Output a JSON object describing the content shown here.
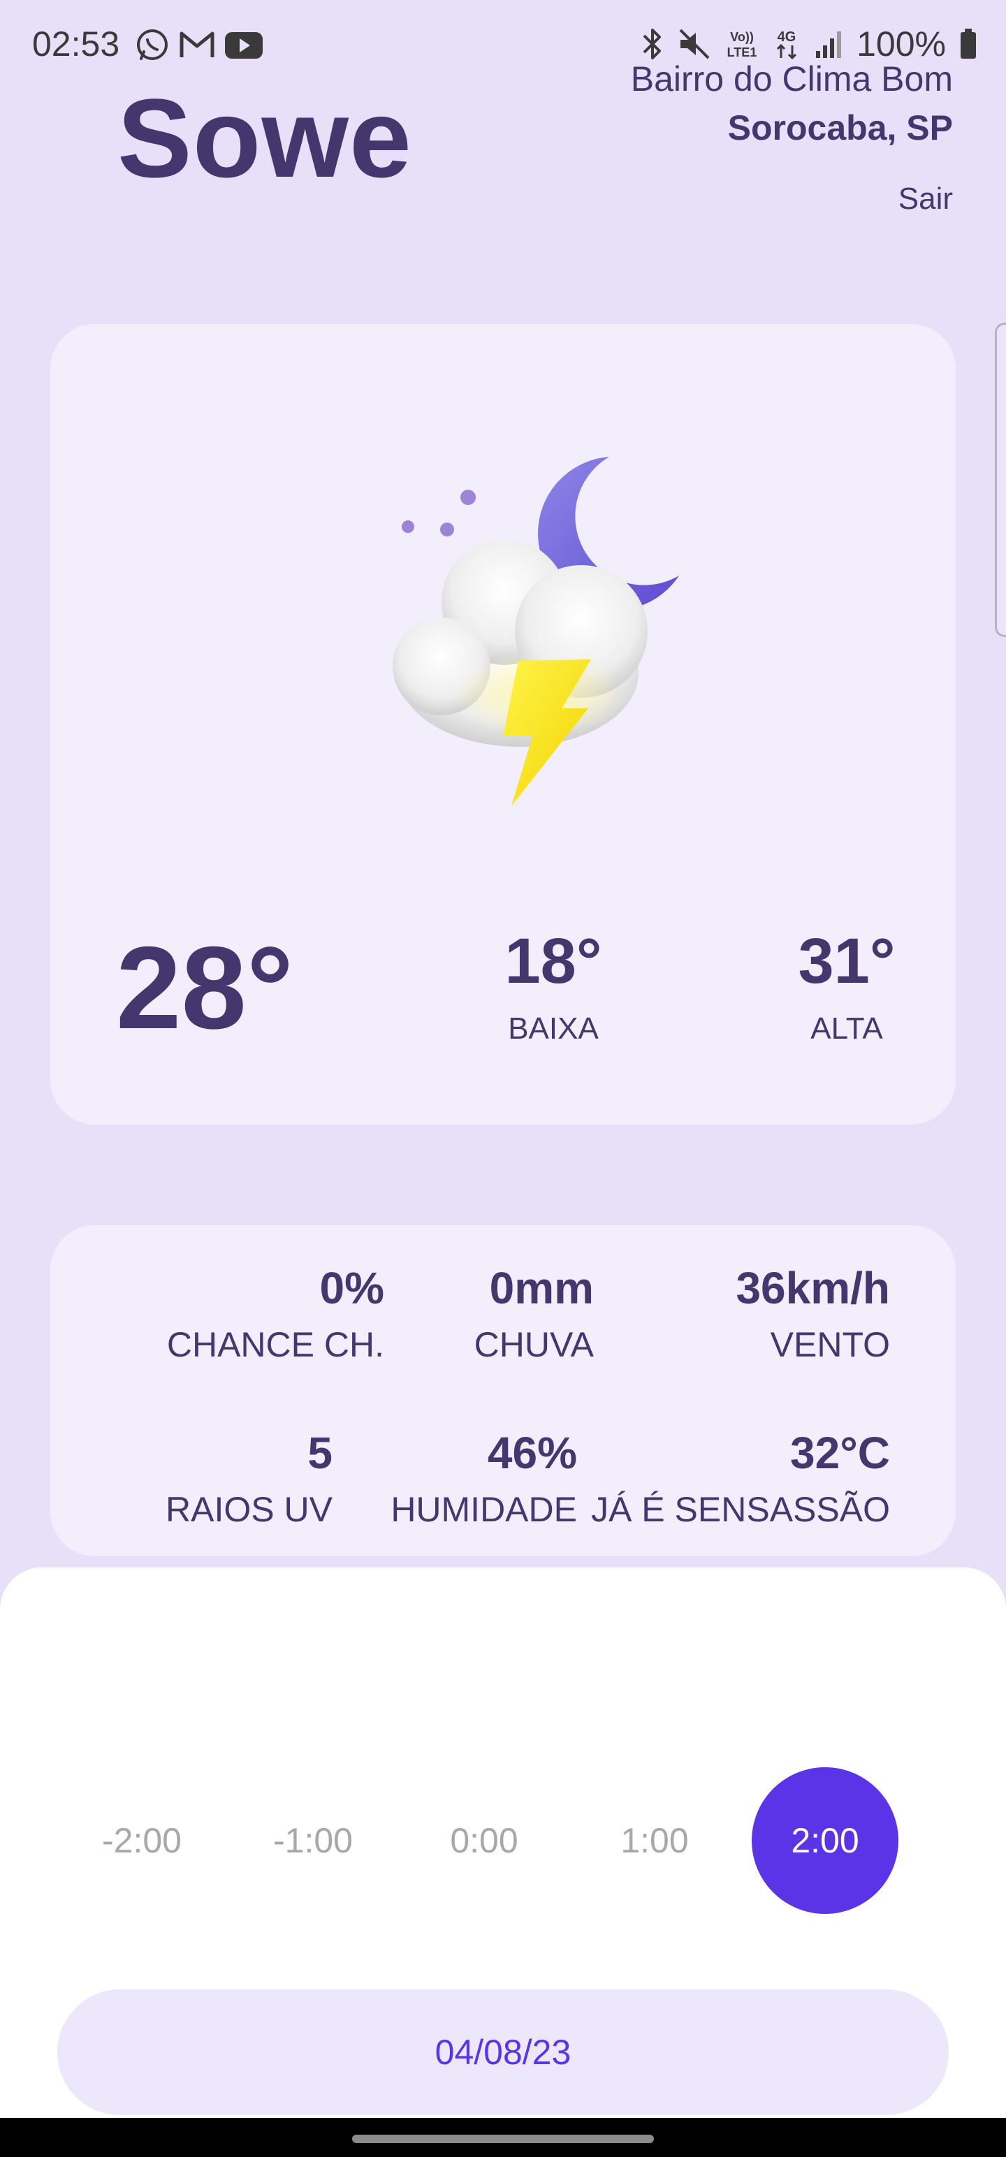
{
  "status_bar": {
    "time": "02:53",
    "left_icons": [
      "whatsapp-icon",
      "gmail-icon",
      "youtube-icon"
    ],
    "right_icons": [
      "bluetooth-icon",
      "mute-icon",
      "volte-icon",
      "network-4g-icon",
      "signal-icon"
    ],
    "battery": "100%"
  },
  "header": {
    "title": "Sowe",
    "neighborhood": "Bairro do Clima Bom",
    "city": "Sorocaba, SP",
    "logout": "Sair"
  },
  "weather": {
    "icon": "thunderstorm-night-icon",
    "current_temp": "28°",
    "low_temp": "18°",
    "low_label": "BAIXA",
    "high_temp": "31°",
    "high_label": "ALTA"
  },
  "details": {
    "rain_chance": {
      "value": "0%",
      "label": "CHANCE CH."
    },
    "rain": {
      "value": "0mm",
      "label": "CHUVA"
    },
    "wind": {
      "value": "36km/h",
      "label": "VENTO"
    },
    "uv": {
      "value": "5",
      "label": "RAIOS UV"
    },
    "humidity": {
      "value": "46%",
      "label": "HUMIDADE"
    },
    "feels_like": {
      "value": "32°C",
      "label": "JÁ É SENSASSÃO"
    }
  },
  "timeline": {
    "hours": [
      "-2:00",
      "-1:00",
      "0:00",
      "1:00",
      "2:00"
    ],
    "selected_index": 4
  },
  "date": "04/08/23",
  "colors": {
    "background": "#e8e0f8",
    "card": "#f3eefc",
    "primary_text": "#45376e",
    "accent": "#5b34e7"
  }
}
